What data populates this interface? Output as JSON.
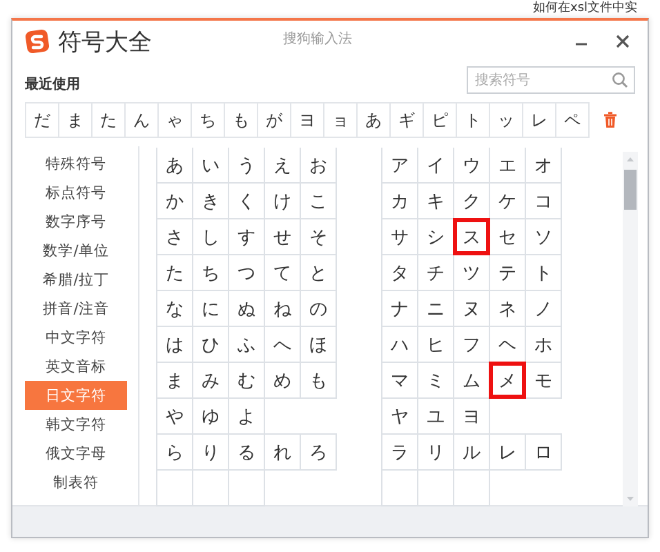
{
  "background": {
    "headline": "如何在xsl文件中实"
  },
  "window": {
    "title": "符号大全",
    "subtitle": "搜狗输入法"
  },
  "recent": {
    "label": "最近使用",
    "search": {
      "placeholder": "搜索符号"
    },
    "symbols": [
      "だ",
      "ま",
      "た",
      "ん",
      "ゃ",
      "ち",
      "も",
      "が",
      "ヨ",
      "ョ",
      "あ",
      "ギ",
      "ピ",
      "ト",
      "ッ",
      "レ",
      "ペ"
    ]
  },
  "sidebar": {
    "items": [
      {
        "label": "特殊符号",
        "selected": false
      },
      {
        "label": "标点符号",
        "selected": false
      },
      {
        "label": "数字序号",
        "selected": false
      },
      {
        "label": "数学/单位",
        "selected": false
      },
      {
        "label": "希腊/拉丁",
        "selected": false
      },
      {
        "label": "拼音/注音",
        "selected": false
      },
      {
        "label": "中文字符",
        "selected": false
      },
      {
        "label": "英文音标",
        "selected": false
      },
      {
        "label": "日文字符",
        "selected": true
      },
      {
        "label": "韩文字符",
        "selected": false
      },
      {
        "label": "俄文字母",
        "selected": false
      },
      {
        "label": "制表符",
        "selected": false
      }
    ]
  },
  "hiragana": [
    [
      "あ",
      "い",
      "う",
      "え",
      "お"
    ],
    [
      "か",
      "き",
      "く",
      "け",
      "こ"
    ],
    [
      "さ",
      "し",
      "す",
      "せ",
      "そ"
    ],
    [
      "た",
      "ち",
      "つ",
      "て",
      "と"
    ],
    [
      "な",
      "に",
      "ぬ",
      "ね",
      "の"
    ],
    [
      "は",
      "ひ",
      "ふ",
      "へ",
      "ほ"
    ],
    [
      "ま",
      "み",
      "む",
      "め",
      "も"
    ],
    [
      "や",
      "ゆ",
      "よ"
    ],
    [
      "ら",
      "り",
      "る",
      "れ",
      "ろ"
    ]
  ],
  "katakana": [
    [
      {
        "char": "ア",
        "marked": false
      },
      {
        "char": "イ",
        "marked": false
      },
      {
        "char": "ウ",
        "marked": false
      },
      {
        "char": "エ",
        "marked": false
      },
      {
        "char": "オ",
        "marked": false
      }
    ],
    [
      {
        "char": "カ",
        "marked": false
      },
      {
        "char": "キ",
        "marked": false
      },
      {
        "char": "ク",
        "marked": false
      },
      {
        "char": "ケ",
        "marked": false
      },
      {
        "char": "コ",
        "marked": false
      }
    ],
    [
      {
        "char": "サ",
        "marked": false
      },
      {
        "char": "シ",
        "marked": false
      },
      {
        "char": "ス",
        "marked": true
      },
      {
        "char": "セ",
        "marked": false
      },
      {
        "char": "ソ",
        "marked": false
      }
    ],
    [
      {
        "char": "タ",
        "marked": false
      },
      {
        "char": "チ",
        "marked": false
      },
      {
        "char": "ツ",
        "marked": false
      },
      {
        "char": "テ",
        "marked": false
      },
      {
        "char": "ト",
        "marked": false
      }
    ],
    [
      {
        "char": "ナ",
        "marked": false
      },
      {
        "char": "ニ",
        "marked": false
      },
      {
        "char": "ヌ",
        "marked": false
      },
      {
        "char": "ネ",
        "marked": false
      },
      {
        "char": "ノ",
        "marked": false
      }
    ],
    [
      {
        "char": "ハ",
        "marked": false
      },
      {
        "char": "ヒ",
        "marked": false
      },
      {
        "char": "フ",
        "marked": false
      },
      {
        "char": "ヘ",
        "marked": false
      },
      {
        "char": "ホ",
        "marked": false
      }
    ],
    [
      {
        "char": "マ",
        "marked": false
      },
      {
        "char": "ミ",
        "marked": false
      },
      {
        "char": "ム",
        "marked": false
      },
      {
        "char": "メ",
        "marked": true
      },
      {
        "char": "モ",
        "marked": false
      }
    ],
    [
      {
        "char": "ヤ",
        "marked": false
      },
      {
        "char": "ユ",
        "marked": false
      },
      {
        "char": "ヨ",
        "marked": false
      }
    ],
    [
      {
        "char": "ラ",
        "marked": false
      },
      {
        "char": "リ",
        "marked": false
      },
      {
        "char": "ル",
        "marked": false
      },
      {
        "char": "レ",
        "marked": false
      },
      {
        "char": "ロ",
        "marked": false
      }
    ]
  ]
}
